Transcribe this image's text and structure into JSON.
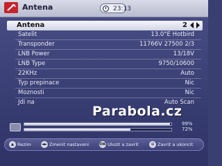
{
  "header": {
    "title": "Antena",
    "time": "23:13"
  },
  "selected_row": {
    "label": "Antena",
    "value": "2"
  },
  "rows": [
    {
      "label": "Satelit",
      "value": "13.0°E Hotbird"
    },
    {
      "label": "Transponder",
      "value": "11766V 27500 2/3"
    },
    {
      "label": "LNB Power",
      "value": "13/18V"
    },
    {
      "label": "LNB Type",
      "value": "9750/10600"
    },
    {
      "label": "22KHz",
      "value": "Auto"
    },
    {
      "label": "Typ prepinace",
      "value": "Nic"
    },
    {
      "label": "Moznosti",
      "value": "Nic"
    },
    {
      "label": "Jdi na",
      "value": "Auto Scan"
    }
  ],
  "watermark": "Parabola.cz",
  "signal": {
    "strength_pct": "99%",
    "quality_pct": "72%",
    "strength_value": 0.99,
    "quality_value": 0.72
  },
  "footer": [
    {
      "key": "▲",
      "label": "Rezim"
    },
    {
      "key": "◄►",
      "label": "Zmenit nastaveni"
    },
    {
      "key": "OK",
      "label": "Ulozit a zavrit"
    },
    {
      "key": "⊙",
      "label": "Zavrit a ukoncit"
    }
  ],
  "colors": {
    "header_bg": "#c9cbdc",
    "screen_bg": "#3e4278",
    "icon_red": "#c7232c"
  }
}
